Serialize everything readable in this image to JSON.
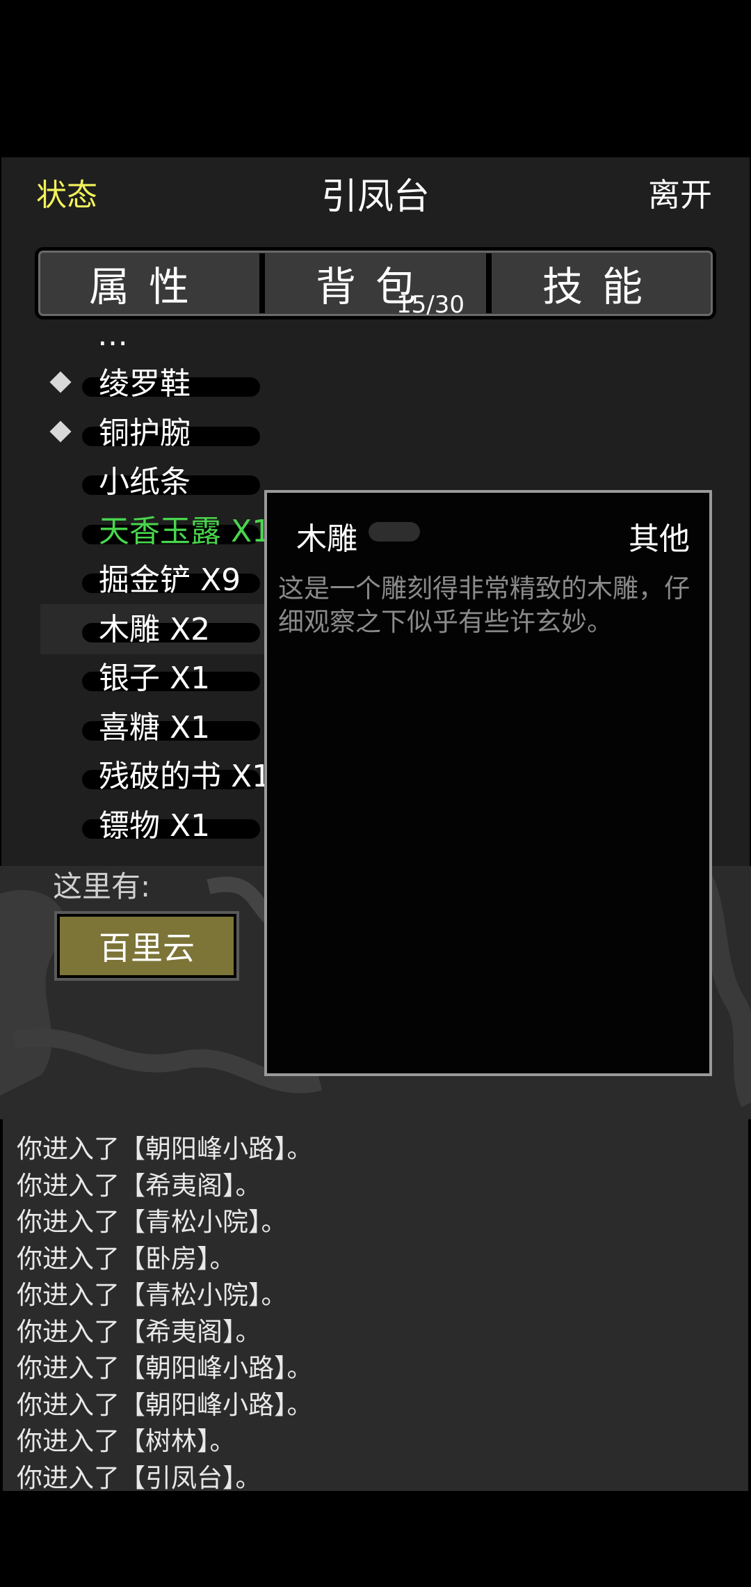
{
  "header": {
    "status_label": "状态",
    "title": "引凤台",
    "leave_label": "离开"
  },
  "tabs": [
    {
      "label": "属性"
    },
    {
      "label": "背包",
      "count": "15/30"
    },
    {
      "label": "技能"
    }
  ],
  "inventory": {
    "items": [
      {
        "label": "绫罗鞋",
        "equipped": true
      },
      {
        "label": "铜护腕",
        "equipped": true
      },
      {
        "label": "小纸条",
        "equipped": false
      },
      {
        "label": "天香玉露 X1",
        "equipped": false,
        "color": "#49d64d"
      },
      {
        "label": "掘金铲 X9",
        "equipped": false
      },
      {
        "label": "木雕 X2",
        "equipped": false,
        "selected": true
      },
      {
        "label": "银子 X1",
        "equipped": false
      },
      {
        "label": "喜糖 X1",
        "equipped": false
      },
      {
        "label": "残破的书 X1",
        "equipped": false
      },
      {
        "label": "镖物 X1",
        "equipped": false
      }
    ]
  },
  "detail": {
    "name": "木雕",
    "type": "其他",
    "description": "这是一个雕刻得非常精致的木雕，仔细观察之下似乎有些许玄妙。"
  },
  "scene": {
    "here_label": "这里有:",
    "npcs": [
      "百里云"
    ]
  },
  "log": [
    "你进入了【朝阳峰小路】。",
    "你进入了【希夷阁】。",
    "你进入了【青松小院】。",
    "你进入了【卧房】。",
    "你进入了【青松小院】。",
    "你进入了【希夷阁】。",
    "你进入了【朝阳峰小路】。",
    "你进入了【朝阳峰小路】。",
    "你进入了【树林】。",
    "你进入了【引凤台】。"
  ],
  "colors": {
    "status_yellow": "#f2f25a",
    "highlight_green": "#49d64d",
    "npc_button": "#7d7538"
  }
}
